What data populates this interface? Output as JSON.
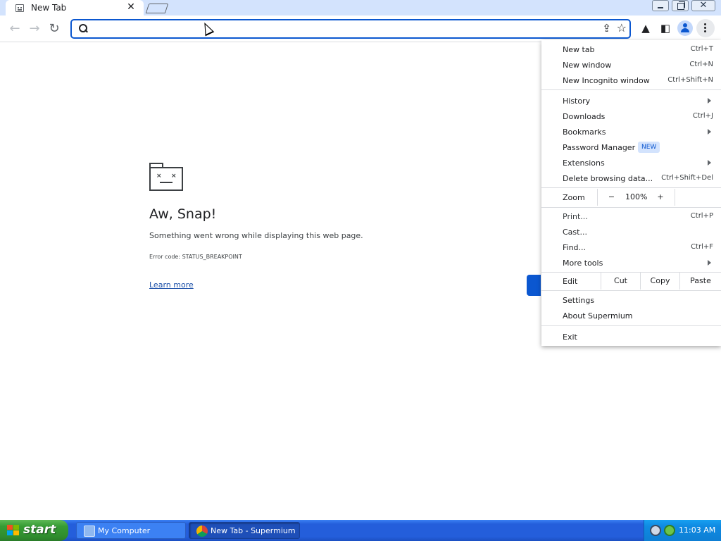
{
  "window": {
    "tab_title": "New Tab",
    "tab_close": "✕",
    "close_glyph": "✕"
  },
  "toolbar": {
    "back_glyph": "←",
    "forward_glyph": "→",
    "reload_glyph": "↻",
    "omnibox_value": "",
    "omnibox_placeholder": "",
    "share_glyph": "⇪",
    "star_glyph": "☆",
    "labs_glyph": "▲",
    "sidepanel_glyph": "◧"
  },
  "error_page": {
    "title": "Aw, Snap!",
    "message": "Something went wrong while displaying this web page.",
    "error_code": "Error code: STATUS_BREAKPOINT",
    "learn_more": "Learn more"
  },
  "menu": {
    "group1": [
      {
        "label": "New tab",
        "shortcut": "Ctrl+T"
      },
      {
        "label": "New window",
        "shortcut": "Ctrl+N"
      },
      {
        "label": "New Incognito window",
        "shortcut": "Ctrl+Shift+N"
      }
    ],
    "group2": [
      {
        "label": "History",
        "shortcut": ""
      },
      {
        "label": "Downloads",
        "shortcut": "Ctrl+J"
      },
      {
        "label": "Bookmarks",
        "shortcut": ""
      },
      {
        "label": "Password Manager",
        "shortcut": ""
      },
      {
        "label": "Extensions",
        "shortcut": ""
      },
      {
        "label": "Delete browsing data...",
        "shortcut": "Ctrl+Shift+Del"
      }
    ],
    "password_badge": "NEW",
    "zoom": {
      "label": "Zoom",
      "minus": "−",
      "value": "100%",
      "plus": "+"
    },
    "group3": [
      {
        "label": "Print...",
        "shortcut": "Ctrl+P"
      },
      {
        "label": "Cast...",
        "shortcut": ""
      },
      {
        "label": "Find...",
        "shortcut": "Ctrl+F"
      },
      {
        "label": "More tools",
        "shortcut": ""
      }
    ],
    "edit": {
      "label": "Edit",
      "cut": "Cut",
      "copy": "Copy",
      "paste": "Paste"
    },
    "group4": [
      {
        "label": "Settings"
      },
      {
        "label": "About Supermium"
      }
    ],
    "exit": "Exit"
  },
  "taskbar": {
    "start_label": "start",
    "task1": "My Computer",
    "task2": "New Tab - Supermium",
    "clock": "11:03 AM"
  },
  "colors": {
    "accent": "#0b57d0",
    "tab_strip": "#d3e3fd",
    "taskbar": "#245edb",
    "start_green": "#379c35"
  }
}
